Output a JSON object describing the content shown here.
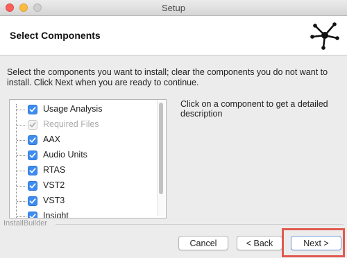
{
  "window": {
    "title": "Setup"
  },
  "header": {
    "title": "Select Components"
  },
  "instructions": "Select the components you want to install; clear the components you do not want to install. Click Next when you are ready to continue.",
  "components": [
    {
      "label": "Usage Analysis",
      "checked": true,
      "disabled": false
    },
    {
      "label": "Required Files",
      "checked": true,
      "disabled": true
    },
    {
      "label": "AAX",
      "checked": true,
      "disabled": false
    },
    {
      "label": "Audio Units",
      "checked": true,
      "disabled": false
    },
    {
      "label": "RTAS",
      "checked": true,
      "disabled": false
    },
    {
      "label": "VST2",
      "checked": true,
      "disabled": false
    },
    {
      "label": "VST3",
      "checked": true,
      "disabled": false
    },
    {
      "label": "Insight",
      "checked": true,
      "disabled": false
    }
  ],
  "description": "Click on a component to get a detailed description",
  "branding": "InstallBuilder",
  "buttons": {
    "cancel": "Cancel",
    "back": "< Back",
    "next": "Next >"
  },
  "colors": {
    "checkbox": "#3d8cf0",
    "highlight": "#e25a4f"
  }
}
